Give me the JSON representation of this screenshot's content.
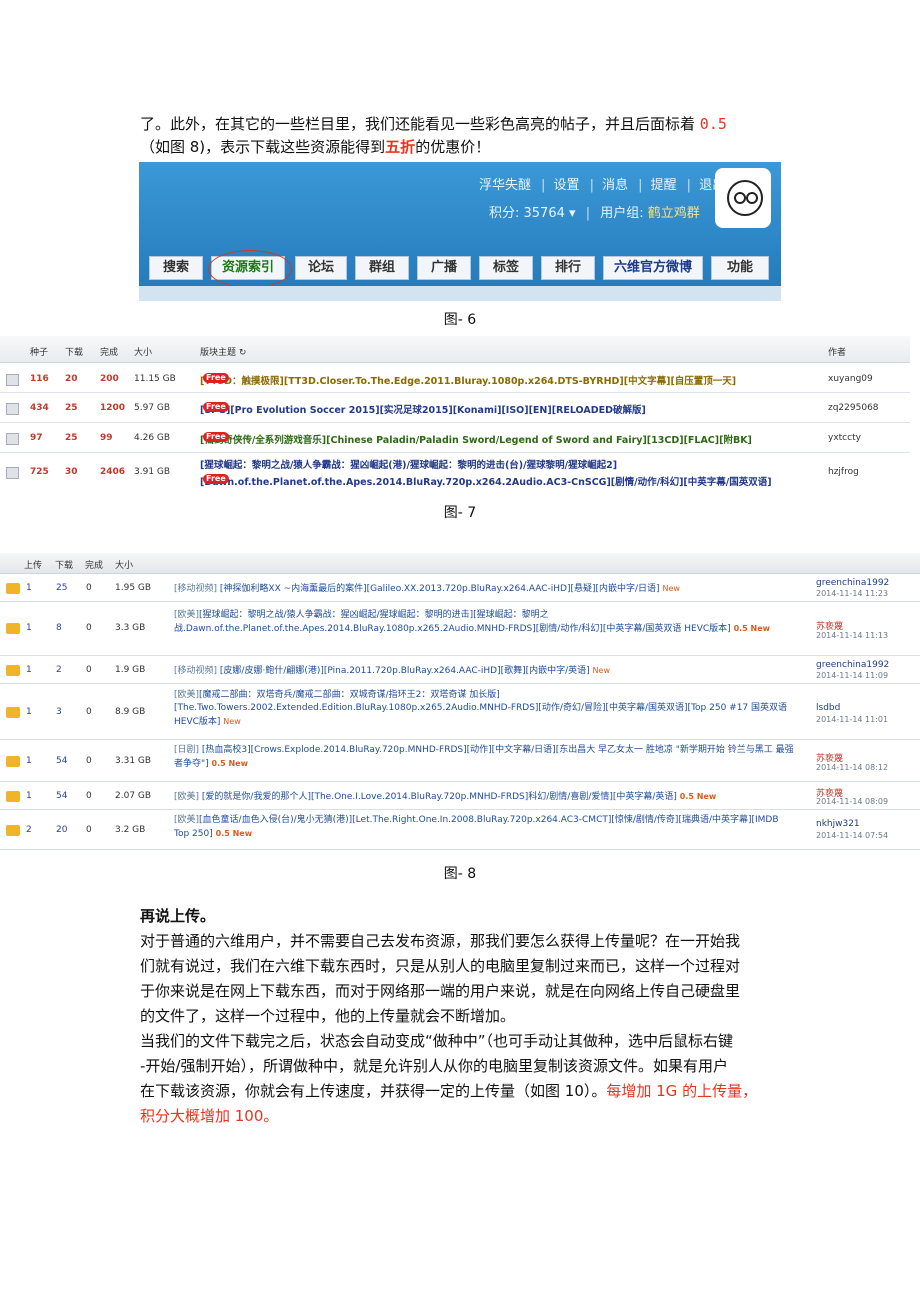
{
  "intro": {
    "line1_a": "了。此外，在其它的一些栏目里，我们还能看见一些彩色高亮的帖子，并且后面标着",
    "line1_b": "0.5",
    "line2_a": "（如图 8)，表示下载这些资源能得到",
    "line2_b": "五折",
    "line2_c": "的优惠价！"
  },
  "fig6": {
    "username": "浮华失醚",
    "links": [
      "设置",
      "消息",
      "提醒",
      "退出"
    ],
    "points_label": "积分: 35764",
    "group_label": "用户组:",
    "group_value": "鹤立鸡群",
    "nav": [
      "搜索",
      "资源索引",
      "论坛",
      "群组",
      "广播",
      "标签",
      "排行",
      "六维官方微博",
      "功能"
    ],
    "caption": "图- 6"
  },
  "fig7": {
    "headers": [
      "种子",
      "下载",
      "完成",
      "大小",
      "版块主题",
      "作者"
    ],
    "rows": [
      {
        "seed": "116",
        "dl": "20",
        "done": "200",
        "size": "11.15 GB",
        "title": "[TT3D：触摸极限][TT3D.Closer.To.The.Edge.2011.Bluray.1080p.x264.DTS-BYRHD][中文字幕][自压置顶一天]",
        "author": "xuyang09"
      },
      {
        "seed": "434",
        "dl": "25",
        "done": "1200",
        "size": "5.97 GB",
        "title": "[SPG][Pro Evolution Soccer 2015][实况足球2015][Konami][ISO][EN][RELOADED破解版]",
        "author": "zq2295068"
      },
      {
        "seed": "97",
        "dl": "25",
        "done": "99",
        "size": "4.26 GB",
        "title": "[仙剑奇侠传/全系列游戏音乐][Chinese Paladin/Paladin Sword/Legend of Sword and Fairy][13CD][FLAC][附BK]",
        "author": "yxtccty"
      },
      {
        "seed": "725",
        "dl": "30",
        "done": "2406",
        "size": "3.91 GB",
        "title1": "[猩球崛起：黎明之战/猿人争霸战：猩凶崛起(港)/猩球崛起：黎明的进击(台)/猩球黎明/猩球崛起2]",
        "title2": "[Dawn.of.the.Planet.of.the.Apes.2014.BluRay.720p.x264.2Audio.AC3-CnSCG][剧情/动作/科幻][中英字幕/国英双语]",
        "author": "hzjfrog"
      }
    ],
    "free_label": "Free",
    "caption": "图- 7"
  },
  "fig8": {
    "headers": [
      "上传",
      "下载",
      "完成",
      "大小"
    ],
    "rows": [
      {
        "up": "1",
        "dl": "25",
        "done": "0",
        "size": "1.95 GB",
        "cat": "[移动视频]",
        "title": "[神探伽利略XX ~内海薰最后的案件][Galileo.XX.2013.720p.BluRay.x264.AAC-iHD][悬疑][内嵌中字/日语]",
        "tag": "New",
        "user": "greenchina1992",
        "date": "2014-11-14 11:23"
      },
      {
        "up": "1",
        "dl": "8",
        "done": "0",
        "size": "3.3 GB",
        "cat": "[欧美]",
        "title": "[猩球崛起：黎明之战/猿人争霸战：猩凶崛起/猩球崛起：黎明的进击][猩球崛起：黎明之战.Dawn.of.the.Planet.of.the.Apes.2014.BluRay.1080p.x265.2Audio.MNHD-FRDS][剧情/动作/科幻][中英字幕/国英双语 HEVC版本]",
        "tag": "0.5 New",
        "user": "苏亵蔑",
        "date": "2014-11-14 11:13"
      },
      {
        "up": "1",
        "dl": "2",
        "done": "0",
        "size": "1.9 GB",
        "cat": "[移动视频]",
        "title": "[皮娜/皮娜·鲍什/翩娜(港)][Pina.2011.720p.BluRay.x264.AAC-iHD][歌舞][内嵌中字/英语]",
        "tag": "New",
        "user": "greenchina1992",
        "date": "2014-11-14 11:09"
      },
      {
        "up": "1",
        "dl": "3",
        "done": "0",
        "size": "8.9 GB",
        "cat": "[欧美]",
        "title": "[魔戒二部曲：双塔奇兵/魔戒二部曲：双城奇谋/指环王2：双塔奇谋 加长版][The.Two.Towers.2002.Extended.Edition.BluRay.1080p.x265.2Audio.MNHD-FRDS][动作/奇幻/冒险][中英字幕/国英双语][Top 250 #17 国英双语 HEVC版本]",
        "tag": "New",
        "user": "lsdbd",
        "date": "2014-11-14 11:01"
      },
      {
        "up": "1",
        "dl": "54",
        "done": "0",
        "size": "3.31 GB",
        "cat": "[日剧]",
        "title": "[热血高校3][Crows.Explode.2014.BluRay.720p.MNHD-FRDS][动作][中文字幕/日语][东出昌大 早乙女太一 胜地凉 \"新学期开始 铃兰与黑工 最强者争夺\"]",
        "tag": "0.5 New",
        "user": "苏亵蔑",
        "date": "2014-11-14 08:12"
      },
      {
        "up": "1",
        "dl": "54",
        "done": "0",
        "size": "2.07 GB",
        "cat": "[欧美]",
        "title": "[爱的就是你/我爱的那个人][The.One.I.Love.2014.BluRay.720p.MNHD-FRDS]科幻/剧情/喜剧/爱情][中英字幕/英语]",
        "tag": "0.5 New",
        "user": "苏亵蔑",
        "date": "2014-11-14 08:09"
      },
      {
        "up": "2",
        "dl": "20",
        "done": "0",
        "size": "3.2 GB",
        "cat": "[欧美]",
        "title": "[血色童话/血色入侵(台)/鬼小无猜(港)][Let.The.Right.One.In.2008.BluRay.720p.x264.AC3-CMCT][惊悚/剧情/传奇][瑞典语/中英字幕][IMDB Top 250]",
        "tag": "0.5 New",
        "user": "nkhjw321",
        "date": "2014-11-14 07:54"
      }
    ],
    "caption": "图- 8"
  },
  "body": {
    "heading": "再说上传。",
    "p1_l1": "对于普通的六维用户，并不需要自己去发布资源，那我们要怎么获得上传量呢？在一开始我",
    "p1_l2": "们就有说过，我们在六维下载东西时，只是从别人的电脑里复制过来而已，这样一个过程对",
    "p1_l3": "于你来说是在网上下载东西，而对于网络那一端的用户来说，就是在向网络上传自己硬盘里",
    "p1_l4": "的文件了，这样一个过程中，他的上传量就会不断增加。",
    "p2_l1": "当我们的文件下载完之后，状态会自动变成“做种中”（也可手动让其做种，选中后鼠标右键",
    "p2_l2": "-开始/强制开始），所谓做种中，就是允许别人从你的电脑里复制该资源文件。如果有用户",
    "p2_l3a": "在下载该资源，你就会有上传速度，并获得一定的上传量（如图 10）。",
    "p2_l3b": "每增加 1G 的上传量，",
    "p2_l4": "积分大概增加 100。"
  }
}
